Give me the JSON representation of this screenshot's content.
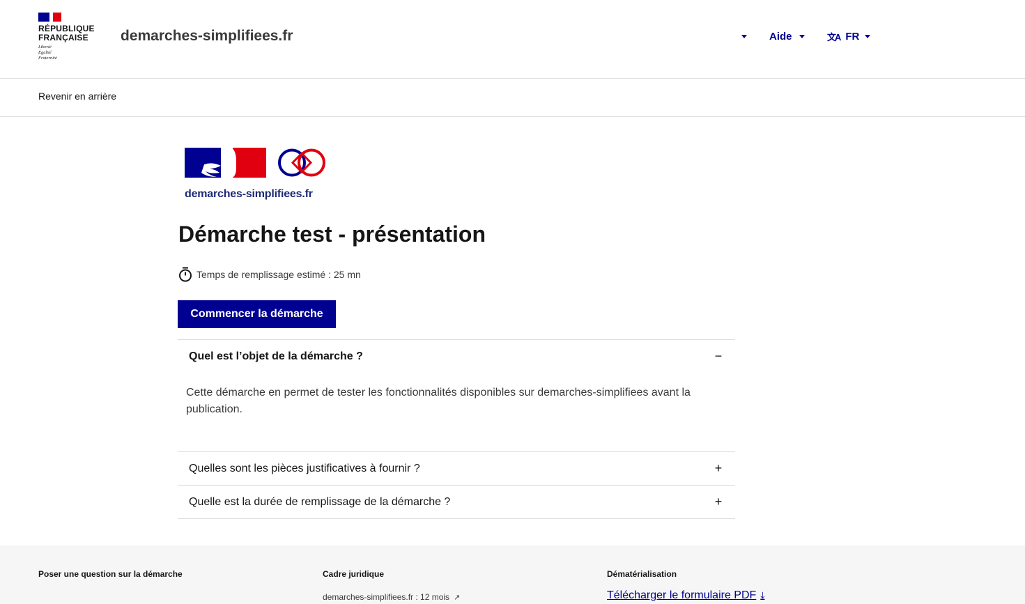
{
  "header": {
    "republique_line1": "RÉPUBLIQUE",
    "republique_line2": "FRANÇAISE",
    "devise": [
      "Liberté",
      "Égalité",
      "Fraternité"
    ],
    "service_title": "demarches-simplifiees.fr",
    "help_label": "Aide",
    "lang_label": "FR"
  },
  "backbar": {
    "back_label": "Revenir en arrière"
  },
  "main": {
    "logo_text": "demarches-simplifiees.fr",
    "title": "Démarche test - présentation",
    "estimated_time": "Temps de remplissage estimé : 25 mn",
    "start_button": "Commencer la démarche",
    "accordion": [
      {
        "title": "Quel est l’objet de la démarche ?",
        "sign": "−",
        "open": true,
        "body": "Cette démarche en permet de tester les fonctionnalités disponibles sur demarches-simplifiees avant la publication."
      },
      {
        "title": "Quelles sont les pièces justificatives à fournir ?",
        "sign": "+",
        "open": false
      },
      {
        "title": "Quelle est la durée de remplissage de la démarche ?",
        "sign": "+",
        "open": false
      }
    ]
  },
  "footer": {
    "col1_title": "Poser une question sur la démarche",
    "col2_title": "Cadre juridique",
    "col2_link": "demarches-simplifiees.fr : 12 mois",
    "col3_title": "Dématérialisation",
    "col3_link": "Télécharger le formulaire PDF"
  },
  "colors": {
    "primary": "#000091",
    "red": "#e1000f",
    "border": "#dddddd",
    "footer_bg": "#f6f6f6"
  }
}
